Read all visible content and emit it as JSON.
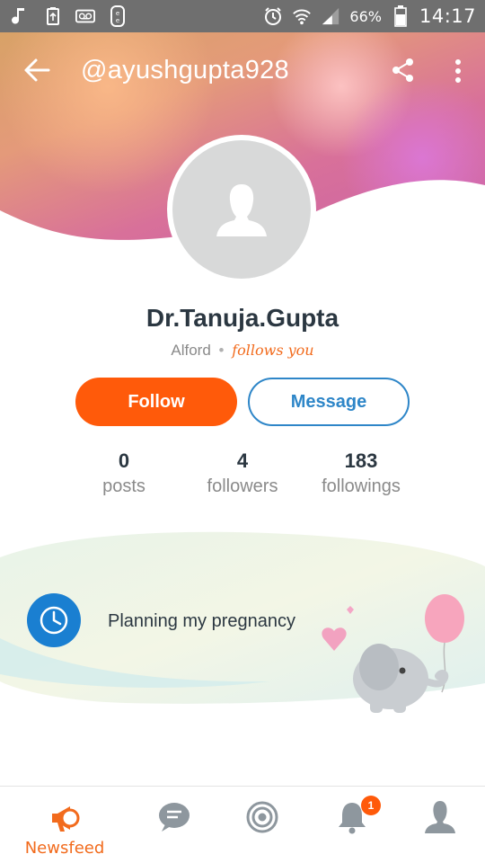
{
  "status_bar": {
    "battery_percent": "66%",
    "time": "14:17",
    "icons": [
      "music-note-icon",
      "recycle-icon",
      "voicemail-icon",
      "ee-icon",
      "alarm-icon",
      "wifi-icon",
      "signal-icon",
      "battery-icon"
    ]
  },
  "header": {
    "username": "@ayushgupta928",
    "back_icon": "arrow-left-icon",
    "share_icon": "share-icon",
    "more_icon": "more-vertical-icon"
  },
  "profile": {
    "name": "Dr.Tanuja.Gupta",
    "location": "Alford",
    "separator": "•",
    "follows_you": "follows you"
  },
  "actions": {
    "follow_label": "Follow",
    "message_label": "Message"
  },
  "stats": [
    {
      "value": "0",
      "label": "posts"
    },
    {
      "value": "4",
      "label": "followers"
    },
    {
      "value": "183",
      "label": "followings"
    }
  ],
  "card": {
    "text": "Planning my pregnancy",
    "icon": "clock-icon"
  },
  "bottom_nav": {
    "items": [
      {
        "icon": "megaphone-icon",
        "label": "Newsfeed"
      },
      {
        "icon": "chat-icon",
        "label": ""
      },
      {
        "icon": "target-icon",
        "label": ""
      },
      {
        "icon": "bell-icon",
        "label": "",
        "badge": "1"
      },
      {
        "icon": "profile-icon",
        "label": ""
      }
    ]
  },
  "colors": {
    "accent": "#ff5a0a",
    "blue": "#2e86c8",
    "text_dark": "#2b3741"
  }
}
